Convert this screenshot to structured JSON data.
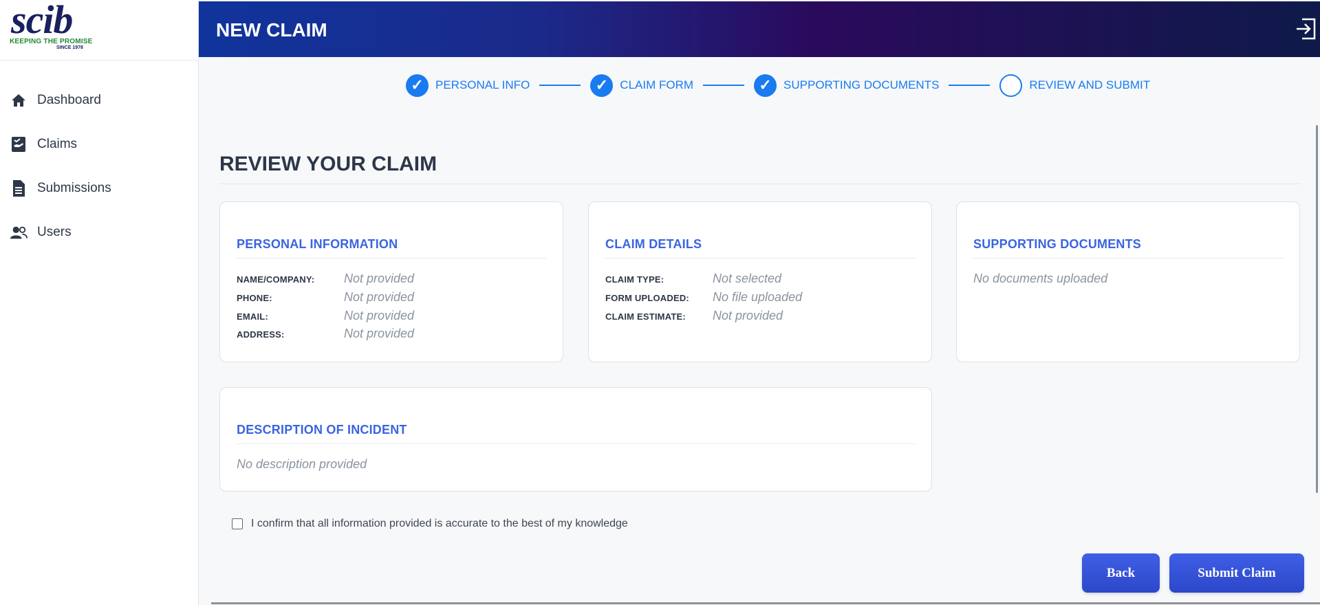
{
  "brand": {
    "wordmark": "scib",
    "tagline": "KEEPING THE PROMISE",
    "since": "SINCE 1978"
  },
  "sidebar": {
    "items": [
      {
        "label": "Dashboard",
        "icon": "home-icon"
      },
      {
        "label": "Claims",
        "icon": "claims-icon"
      },
      {
        "label": "Submissions",
        "icon": "document-icon"
      },
      {
        "label": "Users",
        "icon": "users-icon"
      }
    ]
  },
  "header": {
    "title": "NEW CLAIM",
    "logout_icon": "logout-icon"
  },
  "stepper": {
    "steps": [
      {
        "label": "PERSONAL INFO",
        "done": true
      },
      {
        "label": "CLAIM FORM",
        "done": true
      },
      {
        "label": "SUPPORTING DOCUMENTS",
        "done": true
      },
      {
        "label": "REVIEW AND SUBMIT",
        "done": false
      }
    ],
    "check": "✓"
  },
  "main": {
    "title": "REVIEW YOUR CLAIM",
    "personal": {
      "title": "PERSONAL INFORMATION",
      "rows": [
        {
          "key": "NAME/COMPANY:",
          "value": "Not provided"
        },
        {
          "key": "PHONE:",
          "value": "Not provided"
        },
        {
          "key": "EMAIL:",
          "value": "Not provided"
        },
        {
          "key": "ADDRESS:",
          "value": "Not provided"
        }
      ]
    },
    "claim": {
      "title": "CLAIM DETAILS",
      "rows": [
        {
          "key": "CLAIM TYPE:",
          "value": "Not selected"
        },
        {
          "key": "FORM UPLOADED:",
          "value": "No file uploaded"
        },
        {
          "key": "CLAIM ESTIMATE:",
          "value": "Not provided"
        }
      ]
    },
    "documents": {
      "title": "SUPPORTING DOCUMENTS",
      "value": "No documents uploaded"
    },
    "incident": {
      "title": "DESCRIPTION OF INCIDENT",
      "value": "No description provided"
    },
    "confirm_label": "I confirm that all information provided is accurate to the best of my knowledge",
    "back_label": "Back",
    "submit_label": "Submit Claim"
  },
  "colors": {
    "accent": "#1a7bf0",
    "card_title": "#3a64e0",
    "button": "#3352d8"
  }
}
